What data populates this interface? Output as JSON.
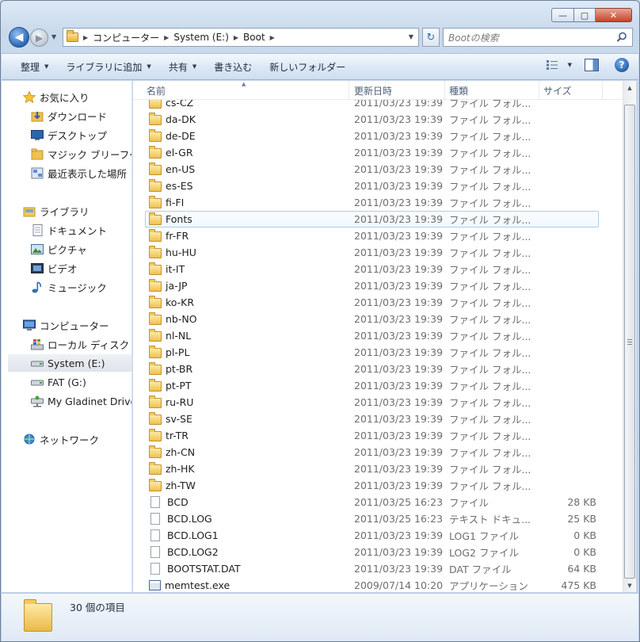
{
  "window": {
    "caption": {
      "minimize": "—",
      "maximize": "▢",
      "close": "✕"
    }
  },
  "nav": {
    "back_glyph": "◀",
    "forward_glyph": "▶",
    "breadcrumbs": [
      "コンピューター",
      "System (E:)",
      "Boot"
    ],
    "refresh_glyph": "↻",
    "search_placeholder": "Bootの検索"
  },
  "toolbar": {
    "organize": "整理",
    "add_to_library": "ライブラリに追加",
    "share": "共有",
    "burn": "書き込む",
    "new_folder": "新しいフォルダー",
    "help": "?"
  },
  "sidebar": {
    "favorites": "お気に入り",
    "downloads": "ダウンロード",
    "desktop": "デスクトップ",
    "magic_briefcase": "マジック ブリーフケ",
    "recent": "最近表示した場所",
    "libraries": "ライブラリ",
    "documents": "ドキュメント",
    "pictures": "ピクチャ",
    "videos": "ビデオ",
    "music": "ミュージック",
    "computer": "コンピューター",
    "local_disk": "ローカル ディスク (",
    "system_e": "System (E:)",
    "fat_g": "FAT (G:)",
    "gladinet": "My Gladinet Drive",
    "network": "ネットワーク"
  },
  "columns": {
    "name": "名前",
    "date": "更新日時",
    "type": "種類",
    "size": "サイズ"
  },
  "files": [
    {
      "name": "cs-CZ",
      "date": "2011/03/23 19:39",
      "type": "ファイル フォル...",
      "size": "",
      "kind": "folder"
    },
    {
      "name": "da-DK",
      "date": "2011/03/23 19:39",
      "type": "ファイル フォル...",
      "size": "",
      "kind": "folder"
    },
    {
      "name": "de-DE",
      "date": "2011/03/23 19:39",
      "type": "ファイル フォル...",
      "size": "",
      "kind": "folder"
    },
    {
      "name": "el-GR",
      "date": "2011/03/23 19:39",
      "type": "ファイル フォル...",
      "size": "",
      "kind": "folder"
    },
    {
      "name": "en-US",
      "date": "2011/03/23 19:39",
      "type": "ファイル フォル...",
      "size": "",
      "kind": "folder"
    },
    {
      "name": "es-ES",
      "date": "2011/03/23 19:39",
      "type": "ファイル フォル...",
      "size": "",
      "kind": "folder"
    },
    {
      "name": "fi-FI",
      "date": "2011/03/23 19:39",
      "type": "ファイル フォル...",
      "size": "",
      "kind": "folder"
    },
    {
      "name": "Fonts",
      "date": "2011/03/23 19:39",
      "type": "ファイル フォル...",
      "size": "",
      "kind": "folder"
    },
    {
      "name": "fr-FR",
      "date": "2011/03/23 19:39",
      "type": "ファイル フォル...",
      "size": "",
      "kind": "folder"
    },
    {
      "name": "hu-HU",
      "date": "2011/03/23 19:39",
      "type": "ファイル フォル...",
      "size": "",
      "kind": "folder"
    },
    {
      "name": "it-IT",
      "date": "2011/03/23 19:39",
      "type": "ファイル フォル...",
      "size": "",
      "kind": "folder"
    },
    {
      "name": "ja-JP",
      "date": "2011/03/23 19:39",
      "type": "ファイル フォル...",
      "size": "",
      "kind": "folder"
    },
    {
      "name": "ko-KR",
      "date": "2011/03/23 19:39",
      "type": "ファイル フォル...",
      "size": "",
      "kind": "folder"
    },
    {
      "name": "nb-NO",
      "date": "2011/03/23 19:39",
      "type": "ファイル フォル...",
      "size": "",
      "kind": "folder"
    },
    {
      "name": "nl-NL",
      "date": "2011/03/23 19:39",
      "type": "ファイル フォル...",
      "size": "",
      "kind": "folder"
    },
    {
      "name": "pl-PL",
      "date": "2011/03/23 19:39",
      "type": "ファイル フォル...",
      "size": "",
      "kind": "folder"
    },
    {
      "name": "pt-BR",
      "date": "2011/03/23 19:39",
      "type": "ファイル フォル...",
      "size": "",
      "kind": "folder"
    },
    {
      "name": "pt-PT",
      "date": "2011/03/23 19:39",
      "type": "ファイル フォル...",
      "size": "",
      "kind": "folder"
    },
    {
      "name": "ru-RU",
      "date": "2011/03/23 19:39",
      "type": "ファイル フォル...",
      "size": "",
      "kind": "folder"
    },
    {
      "name": "sv-SE",
      "date": "2011/03/23 19:39",
      "type": "ファイル フォル...",
      "size": "",
      "kind": "folder"
    },
    {
      "name": "tr-TR",
      "date": "2011/03/23 19:39",
      "type": "ファイル フォル...",
      "size": "",
      "kind": "folder"
    },
    {
      "name": "zh-CN",
      "date": "2011/03/23 19:39",
      "type": "ファイル フォル...",
      "size": "",
      "kind": "folder"
    },
    {
      "name": "zh-HK",
      "date": "2011/03/23 19:39",
      "type": "ファイル フォル...",
      "size": "",
      "kind": "folder"
    },
    {
      "name": "zh-TW",
      "date": "2011/03/23 19:39",
      "type": "ファイル フォル...",
      "size": "",
      "kind": "folder"
    },
    {
      "name": "BCD",
      "date": "2011/03/25 16:23",
      "type": "ファイル",
      "size": "28 KB",
      "kind": "file"
    },
    {
      "name": "BCD.LOG",
      "date": "2011/03/25 16:23",
      "type": "テキスト ドキュ...",
      "size": "25 KB",
      "kind": "file"
    },
    {
      "name": "BCD.LOG1",
      "date": "2011/03/23 19:39",
      "type": "LOG1 ファイル",
      "size": "0 KB",
      "kind": "file"
    },
    {
      "name": "BCD.LOG2",
      "date": "2011/03/23 19:39",
      "type": "LOG2 ファイル",
      "size": "0 KB",
      "kind": "file"
    },
    {
      "name": "BOOTSTAT.DAT",
      "date": "2011/03/23 19:39",
      "type": "DAT ファイル",
      "size": "64 KB",
      "kind": "file"
    },
    {
      "name": "memtest.exe",
      "date": "2009/07/14 10:20",
      "type": "アプリケーション",
      "size": "475 KB",
      "kind": "exe"
    }
  ],
  "details": {
    "count_text": "30 個の項目"
  }
}
